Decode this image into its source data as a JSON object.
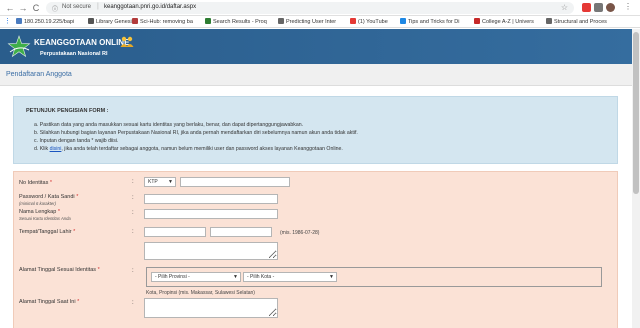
{
  "browser": {
    "nav_back": "←",
    "nav_forward": "→",
    "nav_reload": "C",
    "url_info": "ⓘ",
    "security_label": "Not secure",
    "url_separator": "|",
    "url": "keanggotaan.pnri.go.id/daftar.aspx",
    "star": "☆",
    "menu": "⋮",
    "bookmarks": [
      {
        "label": "180.250.19.225/bapi",
        "icon_color": "#4a7bbf"
      },
      {
        "label": "Library Genesis",
        "icon_color": "#555555"
      },
      {
        "label": "Sci-Hub: removing ba",
        "icon_color": "#b33b3b"
      },
      {
        "label": "Search Results - Proq",
        "icon_color": "#2e7d32"
      },
      {
        "label": "Predicting User Inter",
        "icon_color": "#666666"
      },
      {
        "label": "(1) YouTube",
        "icon_color": "#e53935"
      },
      {
        "label": "Tips and Tricks for Di",
        "icon_color": "#1e88e5"
      },
      {
        "label": "College A-Z | Univers",
        "icon_color": "#c62828"
      },
      {
        "label": "Structural and Proces",
        "icon_color": "#666666"
      }
    ]
  },
  "header": {
    "site_title": "KEANGGOTAAN ONLINE",
    "site_subtitle": "Perpustakaan Nasional RI",
    "brand_color": "#2c5f8e"
  },
  "page": {
    "title": "Pendaftaran Anggota"
  },
  "instructions": {
    "heading": "PETUNJUK PENGISIAN FORM :",
    "items": [
      "a. Pastikan data yang anda masukkan sesuai kartu identitas yang berlaku, benar, dan dapat dipertanggungjawabkan.",
      "b. Silahkan hubungi bagian layanan Perpustakaan Nasional RI, jika anda pernah mendaftarkan diri sebelumnya namun akun anda tidak aktif.",
      "c. Inputan dengan tanda * wajib diisi."
    ],
    "item_d_pre": "d. Klik ",
    "item_d_link": "disini",
    "item_d_post": ", jika anda telah terdaftar sebagai anggota, namun belum memiliki user dan password akses layanan Keanggotaan Online."
  },
  "form": {
    "colon": ":",
    "required_mark": "*",
    "no_identitas": {
      "label": "No Identitas",
      "type_value": "KTP",
      "caret": "▼"
    },
    "password": {
      "label": "Password / Kata Sandi",
      "sublabel": "(minimal 6 karakter)"
    },
    "nama": {
      "label": "Nama Lengkap",
      "sublabel": "Sesuai Kartu Identitas Anda"
    },
    "ttl": {
      "label": "Tempat/Tanggal Lahir",
      "hint": "(mis. 1986-07-28)"
    },
    "alamat_identitas": {
      "label": "Alamat Tinggal Sesuai Identitas",
      "province_placeholder": "- Pilih Provinsi -",
      "city_placeholder": "- Pilih Kota -",
      "caret": "▼",
      "hint": "Kota, Propinsi (mis. Makassar, Sulawesi Selatan)"
    },
    "alamat_saat_ini": {
      "label": "Alamat Tinggal Saat Ini"
    }
  }
}
